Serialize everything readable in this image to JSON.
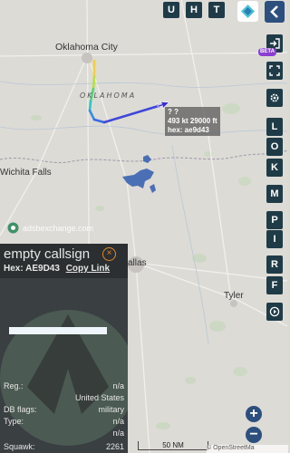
{
  "top_buttons": {
    "u": "U",
    "h": "H",
    "t": "T"
  },
  "side_buttons": {
    "beta": "BETA",
    "l": "L",
    "o": "O",
    "k": "K",
    "m": "M",
    "p": "P",
    "i": "I",
    "r": "R",
    "f": "F"
  },
  "map": {
    "cities": {
      "okc": "Oklahoma City",
      "wichita_falls": "Wichita Falls",
      "dallas": "allas",
      "tyler": "Tyler"
    },
    "state": "OKLAHOMA",
    "watermark": "adsbexchange.com",
    "scale": "50 NM",
    "attribution": "© OpenStreetMa"
  },
  "tooltip": {
    "line1": "?    ?",
    "line2": "493 kt  29000 ft",
    "line3": "hex: ae9d43"
  },
  "panel": {
    "callsign": "empty callsign",
    "close_icon": "×",
    "hex_label": "Hex:",
    "hex_value": "AE9D43",
    "copy_link": "Copy Link",
    "fields": [
      {
        "label": "Reg.:",
        "value": "n/a"
      },
      {
        "label": "",
        "value": "United States"
      },
      {
        "label": "DB flags:",
        "value": "military"
      },
      {
        "label": "Type:",
        "value": "n/a"
      },
      {
        "label": "",
        "value": "n/a"
      },
      {
        "label": "Squawk:",
        "value": "2261"
      }
    ]
  },
  "zoom": {
    "in": "+",
    "out": "−"
  },
  "colors": {
    "button_bg": "#1f3b47",
    "accent_purple": "#8a3fd0",
    "panel_bg": "#3a3f42",
    "aircraft": "#3b2fc9",
    "close": "#e48a2f"
  }
}
